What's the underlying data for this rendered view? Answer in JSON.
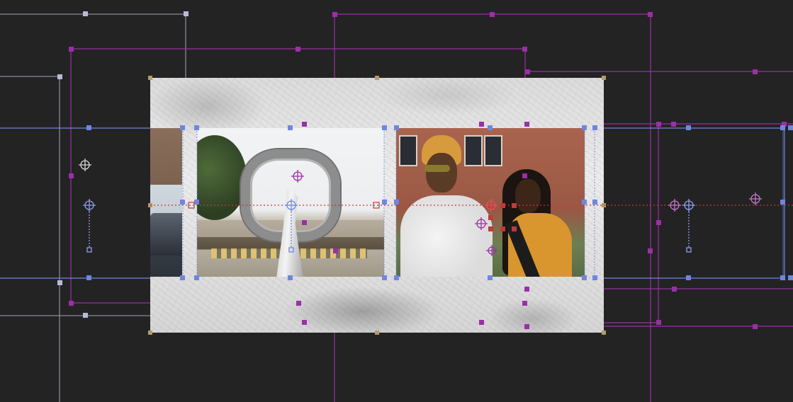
{
  "canvas": {
    "background": "#232323",
    "composition_label": "composition-frame"
  },
  "colors": {
    "layer_blue": "#6f86e0",
    "layer_purple": "#9b2fa7",
    "comp_handle": "#b49a6c",
    "light_guide": "#b8bbd6",
    "motion_path": "#c03a3a"
  },
  "layers": [
    {
      "name": "layer-left-photo",
      "color": "blue",
      "icon": "image-layer-icon"
    },
    {
      "name": "layer-sculpture-photo",
      "color": "blue",
      "icon": "image-layer-icon"
    },
    {
      "name": "layer-people-photo",
      "color": "blue",
      "icon": "image-layer-icon"
    },
    {
      "name": "layer-grunge-texture",
      "color": "purple",
      "icon": "texture-layer-icon"
    }
  ],
  "icons": {
    "anchor": "anchor-point-icon",
    "handle": "transform-handle-icon",
    "motion_path": "motion-path-icon"
  }
}
